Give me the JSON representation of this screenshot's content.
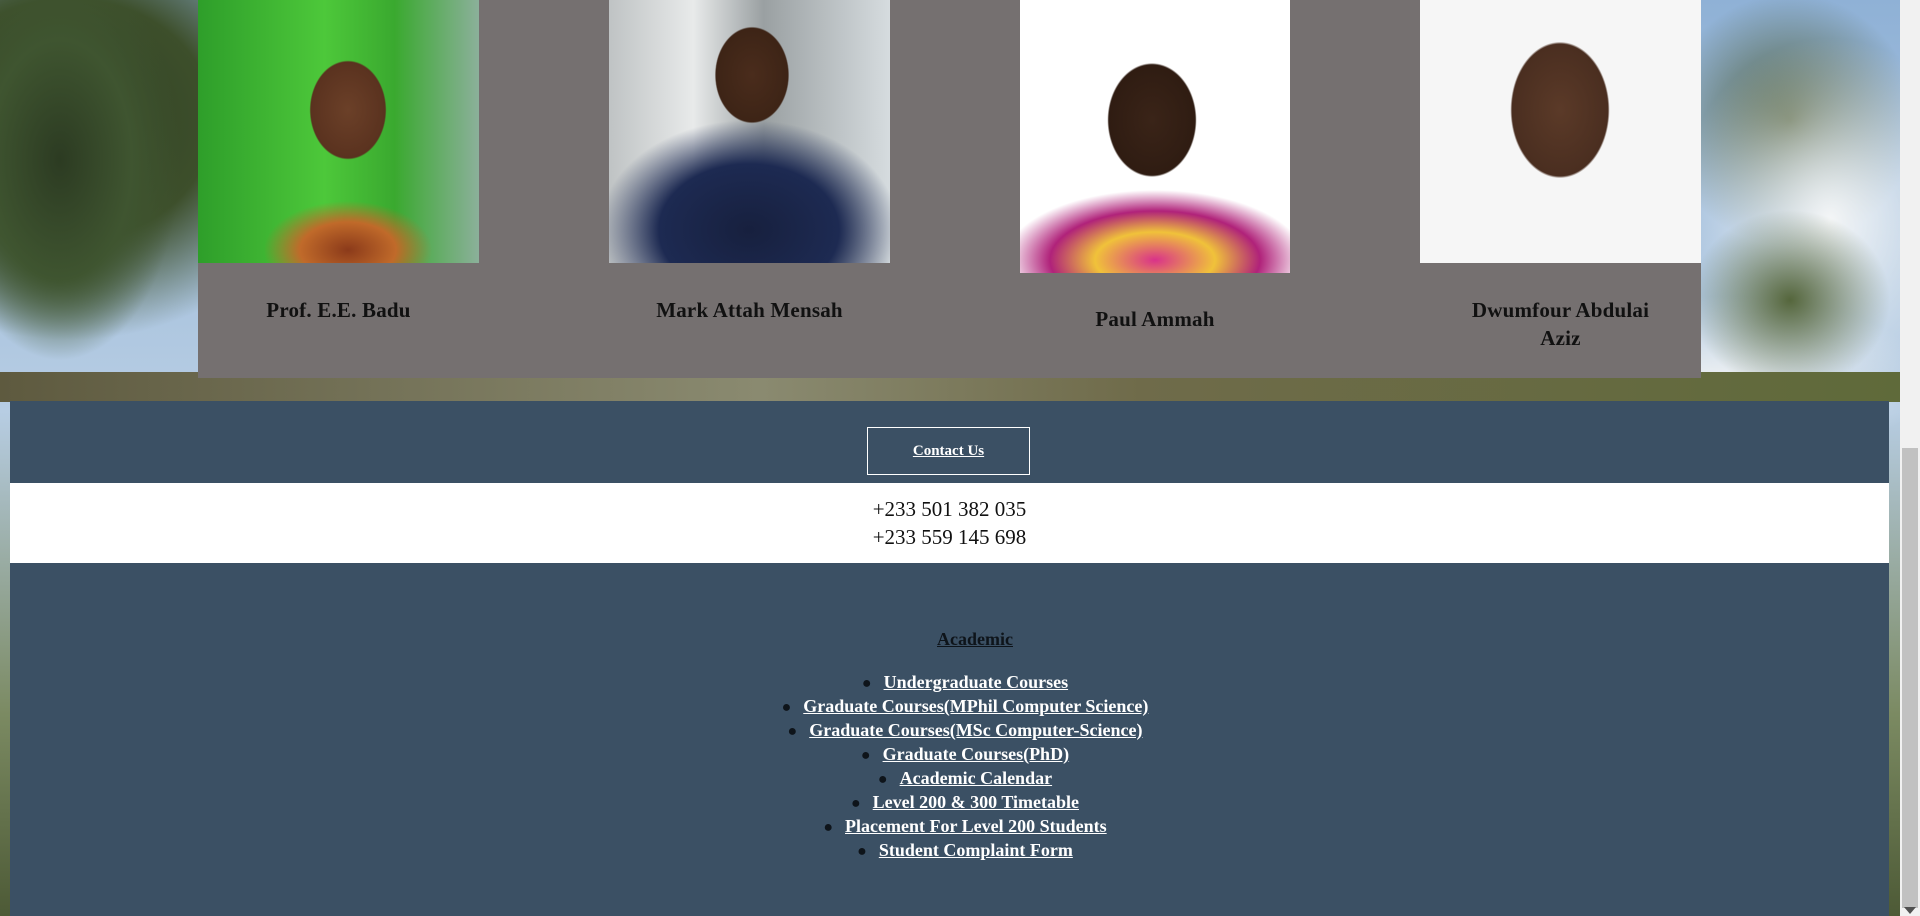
{
  "team": {
    "members": [
      {
        "name": "Prof. E.E. Badu"
      },
      {
        "name": "Mark Attah Mensah"
      },
      {
        "name": "Paul Ammah"
      },
      {
        "name": "Dwumfour Abdulai Aziz"
      }
    ]
  },
  "footer": {
    "contact_label": "Contact Us",
    "phones": [
      "+233 501 382 035",
      "+233 559 145 698"
    ],
    "academic": {
      "heading": "Academic",
      "links": [
        "Undergraduate Courses",
        "Graduate Courses(MPhil Computer Science)",
        "Graduate Courses(MSc Computer-Science)",
        "Graduate Courses(PhD)",
        "Academic Calendar",
        "Level 200 & 300 Timetable",
        "Placement For Level 200 Students",
        "Student Complaint Form"
      ]
    }
  },
  "colors": {
    "team_panel": "#757070",
    "footer_bg": "#3b5064",
    "phone_band": "#ffffff"
  }
}
